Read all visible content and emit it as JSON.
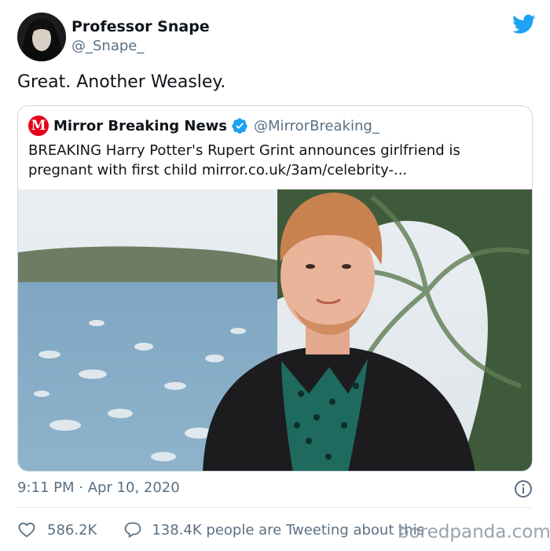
{
  "author": {
    "display_name": "Professor Snape",
    "handle": "@_Snape_"
  },
  "tweet": {
    "text": "Great. Another Weasley."
  },
  "quoted_tweet": {
    "logo_letter": "M",
    "display_name": "Mirror Breaking News",
    "handle": "@MirrorBreaking_",
    "text": "BREAKING Harry Potter's Rupert Grint announces girlfriend is pregnant with first child mirror.co.uk/3am/celebrity-..."
  },
  "meta": {
    "timestamp": "9:11 PM · Apr 10, 2020"
  },
  "engagement": {
    "like_count": "586.2K",
    "reply_text": "138.4K people are Tweeting about this"
  },
  "watermark": "boredpanda.com",
  "colors": {
    "twitter_blue": "#1da1f2",
    "mirror_red": "#e4001b",
    "secondary_text": "#5b7083",
    "border": "#cfd9de"
  },
  "icons": {
    "brand": "twitter-bird-icon",
    "verified": "verified-badge-icon",
    "info": "info-icon",
    "like": "heart-icon",
    "reply": "speech-bubble-icon"
  }
}
